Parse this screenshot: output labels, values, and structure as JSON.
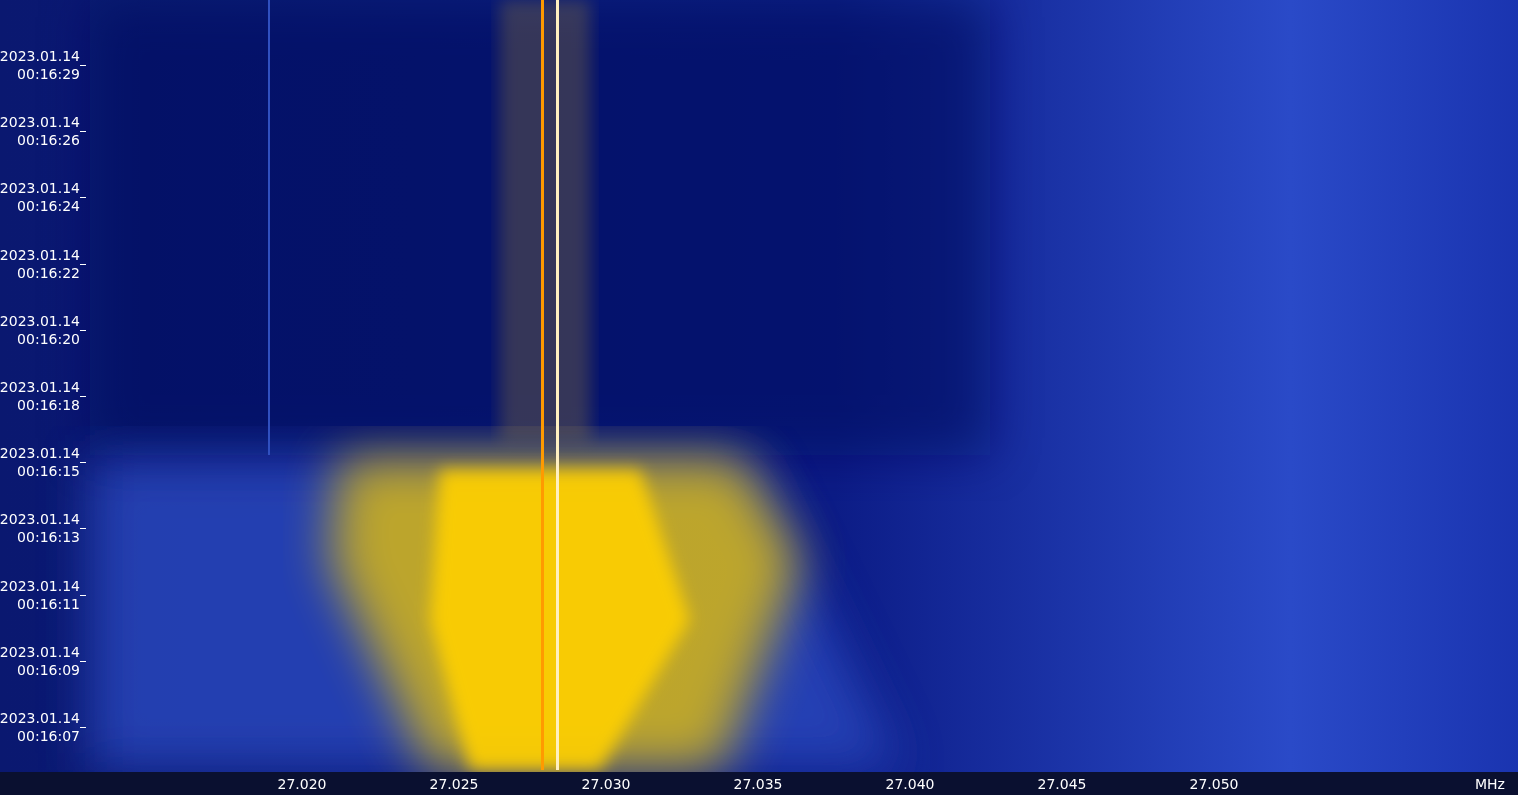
{
  "time_axis": {
    "labels": [
      {
        "date": "2023.01.14",
        "time": "00:16:29"
      },
      {
        "date": "2023.01.14",
        "time": "00:16:26"
      },
      {
        "date": "2023.01.14",
        "time": "00:16:24"
      },
      {
        "date": "2023.01.14",
        "time": "00:16:22"
      },
      {
        "date": "2023.01.14",
        "time": "00:16:20"
      },
      {
        "date": "2023.01.14",
        "time": "00:16:18"
      },
      {
        "date": "2023.01.14",
        "time": "00:16:15"
      },
      {
        "date": "2023.01.14",
        "time": "00:16:13"
      },
      {
        "date": "2023.01.14",
        "time": "00:16:11"
      },
      {
        "date": "2023.01.14",
        "time": "00:16:09"
      },
      {
        "date": "2023.01.14",
        "time": "00:16:07"
      }
    ]
  },
  "frequency_axis": {
    "labels": [
      "27.020",
      "27.025",
      "27.030",
      "27.035",
      "27.040",
      "27.045",
      "27.050"
    ],
    "unit": "MHz"
  }
}
